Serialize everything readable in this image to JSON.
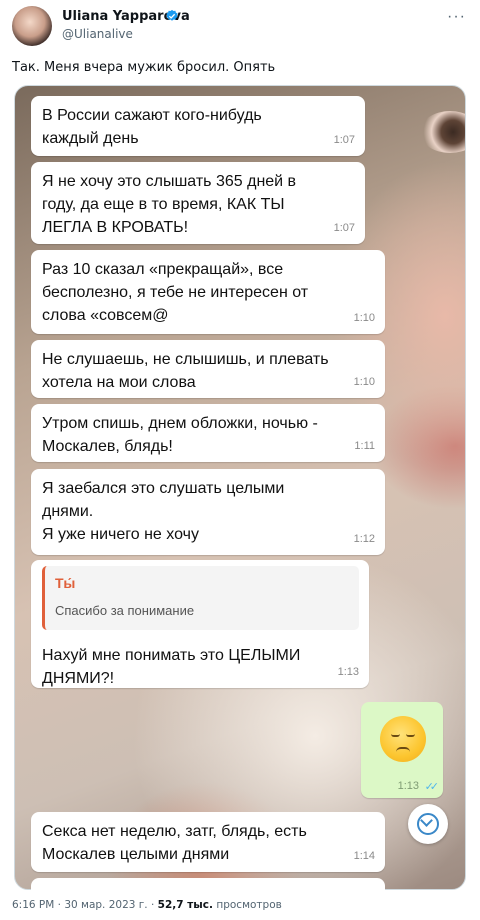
{
  "author": {
    "name": "Uliana Yapparova",
    "handle": "@Ulianalive",
    "verified": true
  },
  "more_label": "···",
  "tweet_text": "Так. Меня вчера мужик бросил. Опять",
  "chat": {
    "messages": [
      {
        "text": "В России сажают кого-нибудь\nкаждый день",
        "time": "1:07"
      },
      {
        "text": "Я не хочу это слышать 365 дней в\nгоду, да еще в то время, КАК ТЫ\nЛЕГЛА В КРОВАТЬ!",
        "time": "1:07"
      },
      {
        "text": "Раз 10 сказал «прекращай», все\nбесполезно, я тебе не интересен от\nслова «совсем@",
        "time": "1:10"
      },
      {
        "text": "Не слушаешь, не слышишь, и плевать\nхотела на мои слова",
        "time": "1:10"
      },
      {
        "text": "Утром спишь, днем обложки, ночью -\nМоскалев, блядь!",
        "time": "1:11"
      },
      {
        "text": "Я заебался это слушать целыми\nднями.\nЯ уже ничего не хочу",
        "time": "1:12"
      },
      {
        "quote_name": "Ты́",
        "quote_text": "Спасибо за понимание",
        "text": "Нахуй мне понимать это ЦЕЛЫМИ\nДНЯМИ?!",
        "time": "1:13"
      },
      {
        "text": "Секса нет неделю, затг, блядь, есть\nМоскалев целыми днями",
        "time": "1:14"
      }
    ],
    "outgoing": {
      "emoji": "pensive-face",
      "time": "1:13",
      "status": "read"
    }
  },
  "meta": {
    "time_date": "6:16 PM · 30 мар. 2023 г. · ",
    "views": "52,7 тыс.",
    "views_label": " просмотров"
  },
  "colors": {
    "quote_accent": "#e0603a",
    "outgoing_bubble": "#dcf8c6",
    "verified_badge": "#1d9bf0",
    "read_ticks": "#4fb6ec"
  }
}
